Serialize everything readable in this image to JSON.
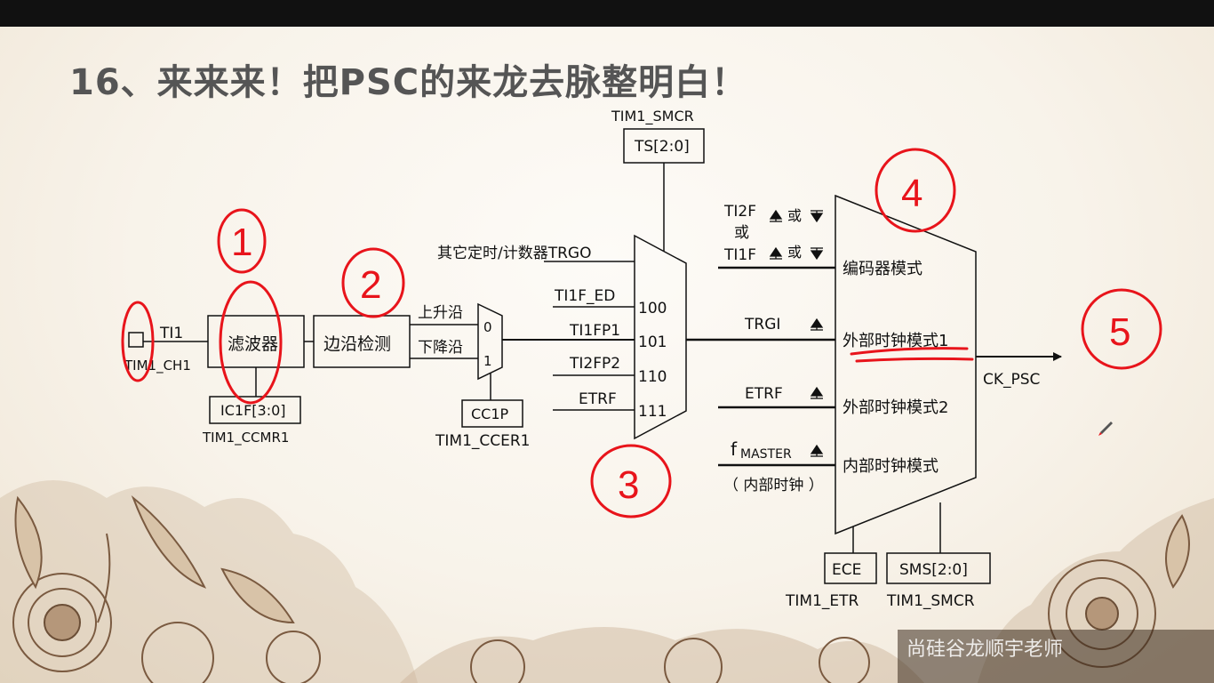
{
  "title": "16、来来来！把PSC的来龙去脉整明白！",
  "input": {
    "pin_label": "TI1",
    "pin_name": "TIM1_CH1"
  },
  "filter": {
    "label": "滤波器",
    "reg_field": "IC1F[3:0]",
    "reg_name": "TIM1_CCMR1"
  },
  "edge_detect": {
    "label": "边沿检测",
    "rising": "上升沿",
    "falling": "下降沿"
  },
  "polarity_mux": {
    "in0": "0",
    "in1": "1",
    "reg_field": "CC1P",
    "reg_name": "TIM1_CCER1"
  },
  "trigger_mux": {
    "reg_name": "TIM1_SMCR",
    "reg_field": "TS[2:0]",
    "inputs": [
      {
        "label": "其它定时/计数器TRGO",
        "code": ""
      },
      {
        "label": "TI1F_ED",
        "code": "100"
      },
      {
        "label": "TI1FP1",
        "code": "101"
      },
      {
        "label": "TI2FP2",
        "code": "110"
      },
      {
        "label": "ETRF",
        "code": "111"
      }
    ]
  },
  "mode_mux": {
    "encoder_inputs": [
      "TI2F",
      "或",
      "TI1F"
    ],
    "or_word": "或",
    "trgi": "TRGI",
    "etrf": "ETRF",
    "fmaster_main": "f",
    "fmaster_sub": "MASTER",
    "internal_clock_note": "（ 内部时钟 ）",
    "modes": [
      "编码器模式",
      "外部时钟模式1",
      "外部时钟模式2",
      "内部时钟模式"
    ],
    "output": "CK_PSC",
    "reg_ece": "ECE",
    "reg_ece_name": "TIM1_ETR",
    "reg_sms": "SMS[2:0]",
    "reg_sms_name": "TIM1_SMCR"
  },
  "annotations": [
    "1",
    "2",
    "3",
    "4",
    "5"
  ],
  "watermark": "尚硅谷龙顺宇老师",
  "colors": {
    "annotation_red": "#e8141b",
    "line_black": "#111111",
    "title_gray": "#555555",
    "decoration_brown": "#8a6a4e"
  }
}
